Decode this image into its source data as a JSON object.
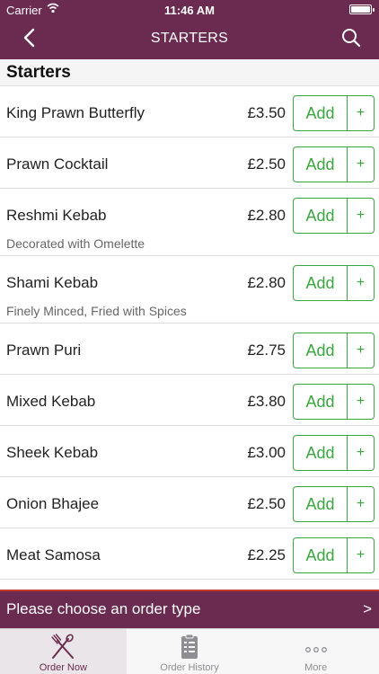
{
  "status_bar": {
    "carrier": "Carrier",
    "time": "11:46 AM"
  },
  "nav": {
    "title": "STARTERS",
    "back_icon": "back-chevron-icon",
    "search_icon": "search-icon"
  },
  "section": {
    "title": "Starters"
  },
  "items": [
    {
      "name": "King Prawn Butterfly",
      "price": "£3.50",
      "add_label": "Add",
      "plus": "+",
      "description": ""
    },
    {
      "name": "Prawn Cocktail",
      "price": "£2.50",
      "add_label": "Add",
      "plus": "+",
      "description": ""
    },
    {
      "name": "Reshmi Kebab",
      "price": "£2.80",
      "add_label": "Add",
      "plus": "+",
      "description": "Decorated with Omelette"
    },
    {
      "name": "Shami Kebab",
      "price": "£2.80",
      "add_label": "Add",
      "plus": "+",
      "description": "Finely Minced, Fried with Spices"
    },
    {
      "name": "Prawn Puri",
      "price": "£2.75",
      "add_label": "Add",
      "plus": "+",
      "description": ""
    },
    {
      "name": "Mixed Kebab",
      "price": "£3.80",
      "add_label": "Add",
      "plus": "+",
      "description": ""
    },
    {
      "name": "Sheek Kebab",
      "price": "£3.00",
      "add_label": "Add",
      "plus": "+",
      "description": ""
    },
    {
      "name": "Onion Bhajee",
      "price": "£2.50",
      "add_label": "Add",
      "plus": "+",
      "description": ""
    },
    {
      "name": "Meat Samosa",
      "price": "£2.25",
      "add_label": "Add",
      "plus": "+",
      "description": ""
    }
  ],
  "order_bar": {
    "text": "Please choose an order type",
    "chevron": ">"
  },
  "tabs": [
    {
      "label": "Order Now",
      "icon": "fork-knife-icon",
      "active": true
    },
    {
      "label": "Order History",
      "icon": "clipboard-icon",
      "active": false
    },
    {
      "label": "More",
      "icon": "more-dots-icon",
      "active": false
    }
  ],
  "colors": {
    "brand": "#6b2b50",
    "accent_green": "#3aa640",
    "alert_line": "#c0392b"
  }
}
